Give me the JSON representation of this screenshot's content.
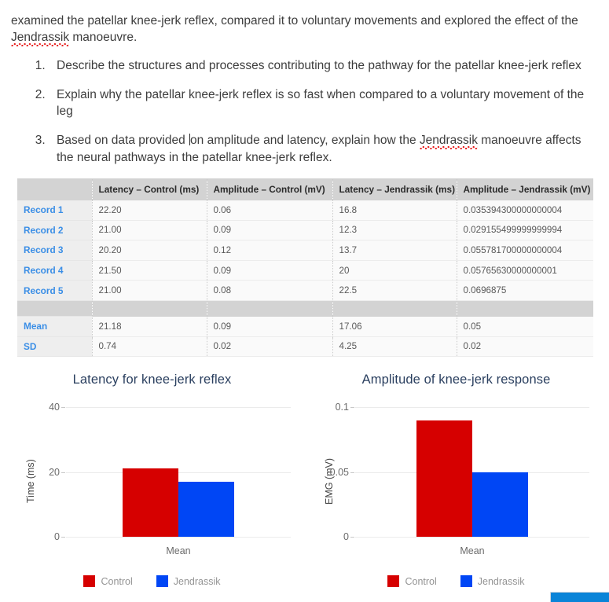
{
  "document": {
    "intro_part1": "examined the patellar knee-jerk reflex, compared it to voluntary movements and explored the effect of the ",
    "intro_misspelled": "Jendrassik",
    "intro_part2": " manoeuvre.",
    "questions": [
      {
        "number": "1.",
        "text": "Describe the structures and processes contributing to the pathway for the patellar knee-jerk reflex"
      },
      {
        "number": "2.",
        "text": "Explain why the patellar knee-jerk reflex is so fast when compared to a voluntary movement of the leg"
      },
      {
        "number": "3.",
        "text_before_caret": "Based on data provided ",
        "text_after_caret": "on amplitude and latency, explain how the ",
        "misspelled": "Jendrassik",
        "text_end": " manoeuvre affects the neural pathways in the patellar knee-jerk reflex."
      }
    ]
  },
  "table": {
    "columns": [
      "",
      "Latency – Control (ms)",
      "Amplitude – Control (mV)",
      "Latency – Jendrassik (ms)",
      "Amplitude – Jendrassik (mV)"
    ],
    "rows": [
      {
        "label": "Record 1",
        "values": [
          "22.20",
          "0.06",
          "16.8",
          "0.035394300000000004"
        ]
      },
      {
        "label": "Record 2",
        "values": [
          "21.00",
          "0.09",
          "12.3",
          "0.029155499999999994"
        ]
      },
      {
        "label": "Record 3",
        "values": [
          "20.20",
          "0.12",
          "13.7",
          "0.055781700000000004"
        ]
      },
      {
        "label": "Record 4",
        "values": [
          "21.50",
          "0.09",
          "20",
          "0.05765630000000001"
        ]
      },
      {
        "label": "Record 5",
        "values": [
          "21.00",
          "0.08",
          "22.5",
          "0.0696875"
        ]
      }
    ],
    "spacer": {
      "label": "",
      "values": [
        "",
        "",
        "",
        ""
      ]
    },
    "summary": [
      {
        "label": "Mean",
        "values": [
          "21.18",
          "0.09",
          "17.06",
          "0.05"
        ]
      },
      {
        "label": "SD",
        "values": [
          "0.74",
          "0.02",
          "4.25",
          "0.02"
        ]
      }
    ]
  },
  "chart_data": [
    {
      "type": "bar",
      "title": "Latency for knee-jerk reflex",
      "xlabel": "",
      "ylabel": "Time (ms)",
      "categories": [
        "Mean"
      ],
      "series": [
        {
          "name": "Control",
          "values": [
            21.18
          ],
          "color": "#d60000"
        },
        {
          "name": "Jendrassik",
          "values": [
            17.06
          ],
          "color": "#0046f5"
        }
      ],
      "ylim": [
        0,
        40
      ],
      "yticks": [
        "0",
        "20",
        "40"
      ],
      "ytick_values": [
        0,
        20,
        40
      ],
      "grid": true,
      "legend_position": "bottom"
    },
    {
      "type": "bar",
      "title": "Amplitude of knee-jerk response",
      "xlabel": "",
      "ylabel": "EMG (mV)",
      "categories": [
        "Mean"
      ],
      "series": [
        {
          "name": "Control",
          "values": [
            0.09
          ],
          "color": "#d60000"
        },
        {
          "name": "Jendrassik",
          "values": [
            0.05
          ],
          "color": "#0046f5"
        }
      ],
      "ylim": [
        0,
        0.1
      ],
      "yticks": [
        "0",
        "0.05",
        "0.1"
      ],
      "ytick_values": [
        0,
        0.05,
        0.1
      ],
      "grid": true,
      "legend_position": "bottom"
    }
  ],
  "colors": {
    "control": "#d60000",
    "jendrassik": "#0046f5",
    "title": "#2a3f5f",
    "link": "#3a8ee6",
    "header_bg": "#d3d3d3",
    "accent_bar": "#0a84d8"
  }
}
